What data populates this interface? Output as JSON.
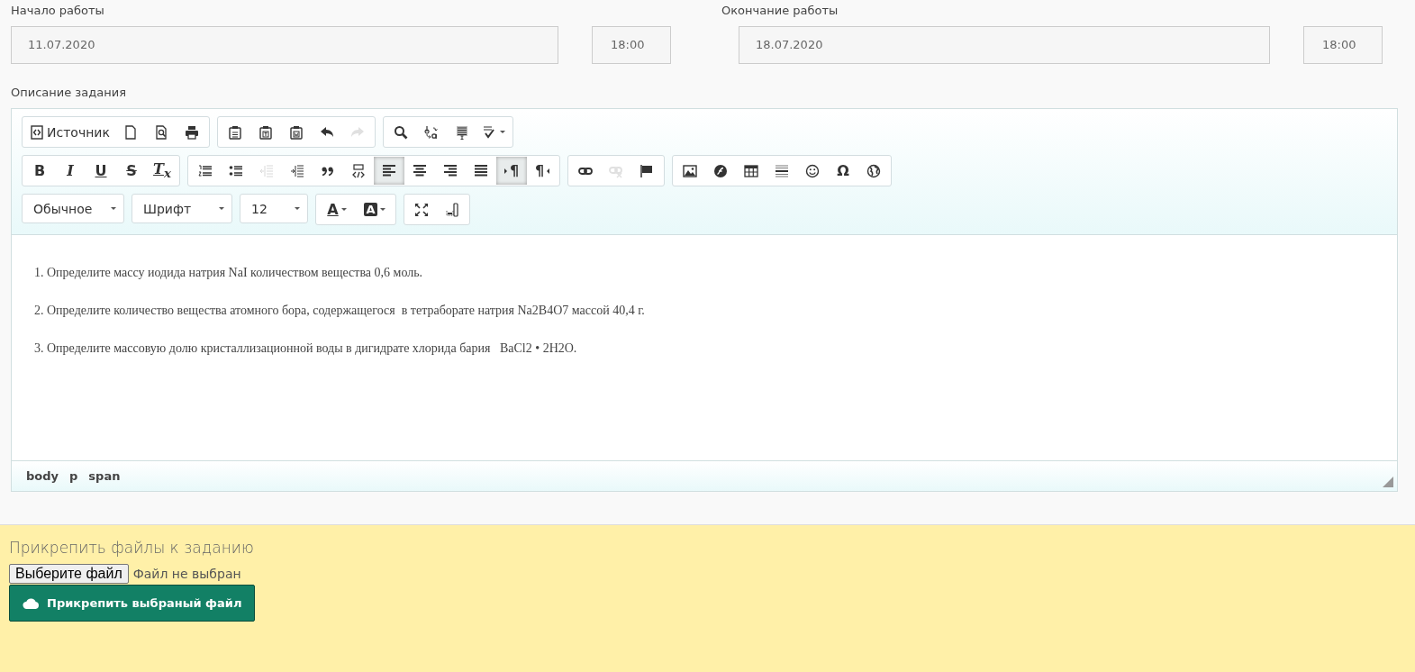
{
  "schedule": [
    {
      "label": "Начало работы",
      "date": "11.07.2020",
      "time": "18:00"
    },
    {
      "label": "Окончание работы",
      "date": "18.07.2020",
      "time": "18:00"
    }
  ],
  "editor": {
    "label": "Описание задания",
    "toolbar": [
      {
        "groups": [
          {
            "items": [
              {
                "kind": "source",
                "label": "Источник",
                "active": false,
                "disabled": false
              },
              {
                "kind": "newpage",
                "active": false,
                "disabled": false
              },
              {
                "kind": "preview",
                "active": false,
                "disabled": false
              },
              {
                "kind": "print",
                "active": false,
                "disabled": false
              }
            ]
          },
          {
            "items": [
              {
                "kind": "paste",
                "active": false,
                "disabled": false
              },
              {
                "kind": "pastetext",
                "active": false,
                "disabled": false
              },
              {
                "kind": "pasteword",
                "active": false,
                "disabled": false
              },
              {
                "kind": "undo",
                "active": false,
                "disabled": false
              },
              {
                "kind": "redo",
                "active": false,
                "disabled": true
              }
            ]
          },
          {
            "items": [
              {
                "kind": "find",
                "active": false,
                "disabled": false
              },
              {
                "kind": "replace",
                "active": false,
                "disabled": false
              },
              {
                "kind": "selectall",
                "active": false,
                "disabled": false
              },
              {
                "kind": "spellcheck",
                "active": false,
                "disabled": false
              }
            ]
          }
        ]
      },
      {
        "groups": [
          {
            "items": [
              {
                "kind": "bold",
                "label": "B",
                "active": false,
                "disabled": false
              },
              {
                "kind": "italic",
                "label": "I",
                "active": false,
                "disabled": false
              },
              {
                "kind": "underline",
                "label": "U",
                "active": false,
                "disabled": false
              },
              {
                "kind": "strike",
                "label": "S",
                "active": false,
                "disabled": false
              },
              {
                "kind": "removeformat",
                "label": "T$_{x}$",
                "active": false,
                "disabled": false
              }
            ]
          },
          {
            "items": [
              {
                "kind": "numlist",
                "active": false,
                "disabled": false
              },
              {
                "kind": "bullist",
                "active": false,
                "disabled": false
              },
              {
                "kind": "outdent",
                "active": false,
                "disabled": true
              },
              {
                "kind": "indent",
                "active": false,
                "disabled": false
              },
              {
                "kind": "blockquote",
                "active": false,
                "disabled": false
              },
              {
                "kind": "div",
                "active": false,
                "disabled": false
              },
              {
                "kind": "alignleft",
                "active": true,
                "disabled": false
              },
              {
                "kind": "aligncenter",
                "active": false,
                "disabled": false
              },
              {
                "kind": "alignright",
                "active": false,
                "disabled": false
              },
              {
                "kind": "alignjustify",
                "active": false,
                "disabled": false
              },
              {
                "kind": "ltr",
                "label": "¶",
                "active": true,
                "disabled": false
              },
              {
                "kind": "rtl",
                "label": "¶",
                "active": false,
                "disabled": false
              }
            ]
          },
          {
            "items": [
              {
                "kind": "link",
                "active": false,
                "disabled": false
              },
              {
                "kind": "unlink",
                "active": false,
                "disabled": true
              },
              {
                "kind": "anchor",
                "active": false,
                "disabled": false
              }
            ]
          },
          {
            "items": [
              {
                "kind": "image",
                "active": false,
                "disabled": false
              },
              {
                "kind": "flash",
                "active": false,
                "disabled": false
              },
              {
                "kind": "table",
                "active": false,
                "disabled": false
              },
              {
                "kind": "hr",
                "active": false,
                "disabled": false
              },
              {
                "kind": "smiley",
                "active": false,
                "disabled": false
              },
              {
                "kind": "specialchar",
                "label": "Ω",
                "active": false,
                "disabled": false
              },
              {
                "kind": "iframe",
                "active": false,
                "disabled": false
              }
            ]
          }
        ]
      },
      {
        "groups": [
          {
            "items": [
              {
                "kind": "combo",
                "label": "Обычное"
              }
            ]
          },
          {
            "items": [
              {
                "kind": "combo",
                "label": "Шрифт"
              }
            ]
          },
          {
            "items": [
              {
                "kind": "combo",
                "label": "12"
              }
            ]
          },
          {
            "items": [
              {
                "kind": "textcolor",
                "label": "A",
                "active": false,
                "disabled": false
              },
              {
                "kind": "bgcolor",
                "label": "A",
                "active": false,
                "disabled": false
              }
            ]
          },
          {
            "items": [
              {
                "kind": "maximize",
                "active": false,
                "disabled": false
              },
              {
                "kind": "showblocks",
                "active": false,
                "disabled": false
              }
            ]
          }
        ]
      }
    ],
    "paragraphs": [
      "1. Определите массу иодида натрия NaI количеством вещества 0,6 моль.",
      "2. Определите количество вещества атомного бора, содержащегося  в тетраборате натрия Na2B4O7 массой 40,4 г.",
      "3. Определите массовую долю кристаллизационной воды в дигидрате хлорида бария   BaCl2 • 2H2O."
    ],
    "path": [
      "body",
      "p",
      "span"
    ]
  },
  "attach": {
    "title": "Прикрепить файлы к заданию",
    "choose_button": "Выберите файл",
    "file_status": "Файл не выбран",
    "submit_button": "Прикрепить выбраный файл"
  }
}
